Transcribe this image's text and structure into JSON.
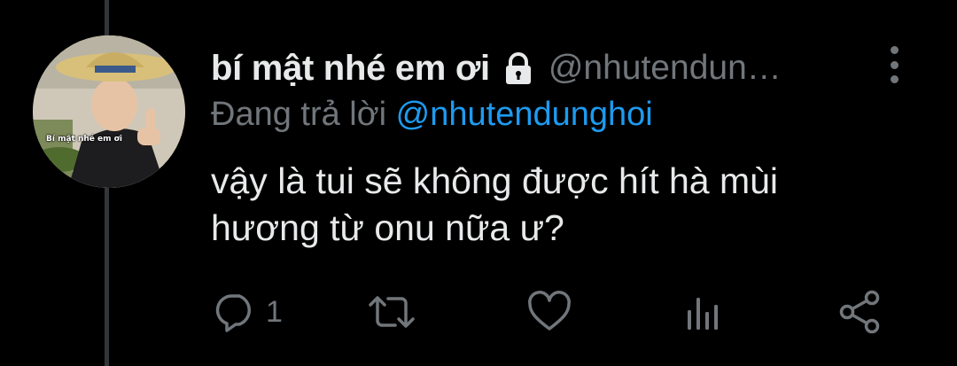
{
  "tweet": {
    "author": {
      "display_name": "bí mật nhé em ơi",
      "handle": "@nhutendun…",
      "avatar_caption": "Bí mật nhé em ơi",
      "protected_icon": "lock-icon"
    },
    "replying_to": {
      "prefix": "Đang trả lời",
      "handle": "@nhutendunghoi"
    },
    "text_lines": [
      "vậy là tui sẽ không được hít hà mùi",
      "hương từ onu nữa ư?"
    ],
    "actions": {
      "reply_icon": "reply-icon",
      "reply_count": "1",
      "retweet_icon": "retweet-icon",
      "like_icon": "heart-icon",
      "analytics_icon": "analytics-icon",
      "share_icon": "share-icon"
    },
    "menu_icon": "more-vertical-icon"
  },
  "colors": {
    "background": "#000000",
    "primary_text": "#e7e9ea",
    "secondary_text": "#71767b",
    "link": "#1d9bf0",
    "thread_line": "#333639"
  }
}
